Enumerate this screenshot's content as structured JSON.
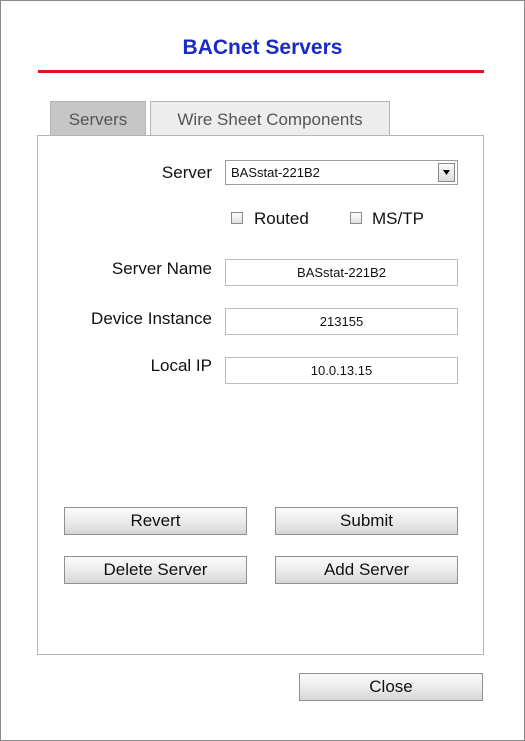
{
  "dialog": {
    "title": "BACnet Servers",
    "colors": {
      "title": "#1a2bc4",
      "rule": "#e0141e"
    }
  },
  "tabs": [
    {
      "label": "Servers",
      "active": false
    },
    {
      "label": "Wire Sheet Components",
      "active": true
    }
  ],
  "form": {
    "server_label": "Server",
    "server_selected": "BASstat-221B2",
    "routed_label": "Routed",
    "routed_checked": false,
    "mstp_label": "MS/TP",
    "mstp_checked": false,
    "server_name_label": "Server Name",
    "server_name_value": "BASstat-221B2",
    "device_instance_label": "Device Instance",
    "device_instance_value": "213155",
    "local_ip_label": "Local IP",
    "local_ip_value": "10.0.13.15"
  },
  "buttons": {
    "revert": "Revert",
    "submit": "Submit",
    "delete_server": "Delete Server",
    "add_server": "Add Server",
    "close": "Close"
  },
  "icons": {
    "dropdown": "chevron-down-icon",
    "checkbox": "checkbox-icon"
  }
}
